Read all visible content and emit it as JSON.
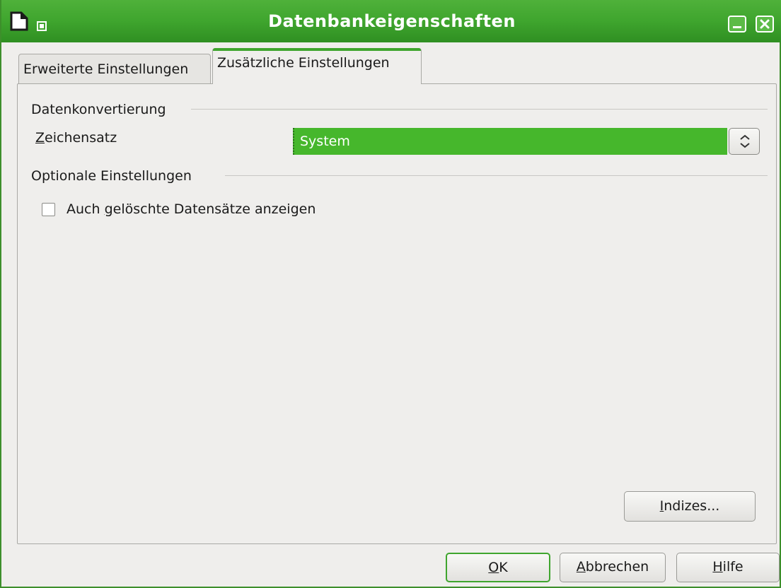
{
  "window": {
    "title": "Datenbankeigenschaften"
  },
  "tabs": [
    {
      "label": "Erweiterte Einstellungen",
      "active": false
    },
    {
      "label": "Zusätzliche Einstellungen",
      "active": true
    }
  ],
  "datenkonvertierung": {
    "heading": "Datenkonvertierung",
    "zeichensatz_label": {
      "mnemonic": "Z",
      "rest": "eichensatz"
    },
    "zeichensatz_value": "System"
  },
  "optional": {
    "heading": "Optionale Einstellungen",
    "checkbox_label": {
      "before": "Auch ",
      "mnemonic": "g",
      "after": "elöschte Datensätze anzeigen"
    },
    "checked": false
  },
  "buttons": {
    "indizes": {
      "mnemonic": "I",
      "rest": "ndizes..."
    },
    "ok": {
      "mnemonic": "O",
      "rest": "K"
    },
    "abbrechen": {
      "mnemonic": "A",
      "rest": "bbrechen"
    },
    "hilfe": {
      "mnemonic": "H",
      "rest": "ilfe"
    }
  },
  "colors": {
    "titlebar": "#3fa52e",
    "selection": "#46b72c",
    "dialog_bg": "#efeeec"
  },
  "icons": {
    "app": "document-icon",
    "window_menu": "window-menu-icon",
    "minimize": "minimize-icon",
    "close": "close-icon",
    "spinner": "updown-arrows-icon"
  }
}
